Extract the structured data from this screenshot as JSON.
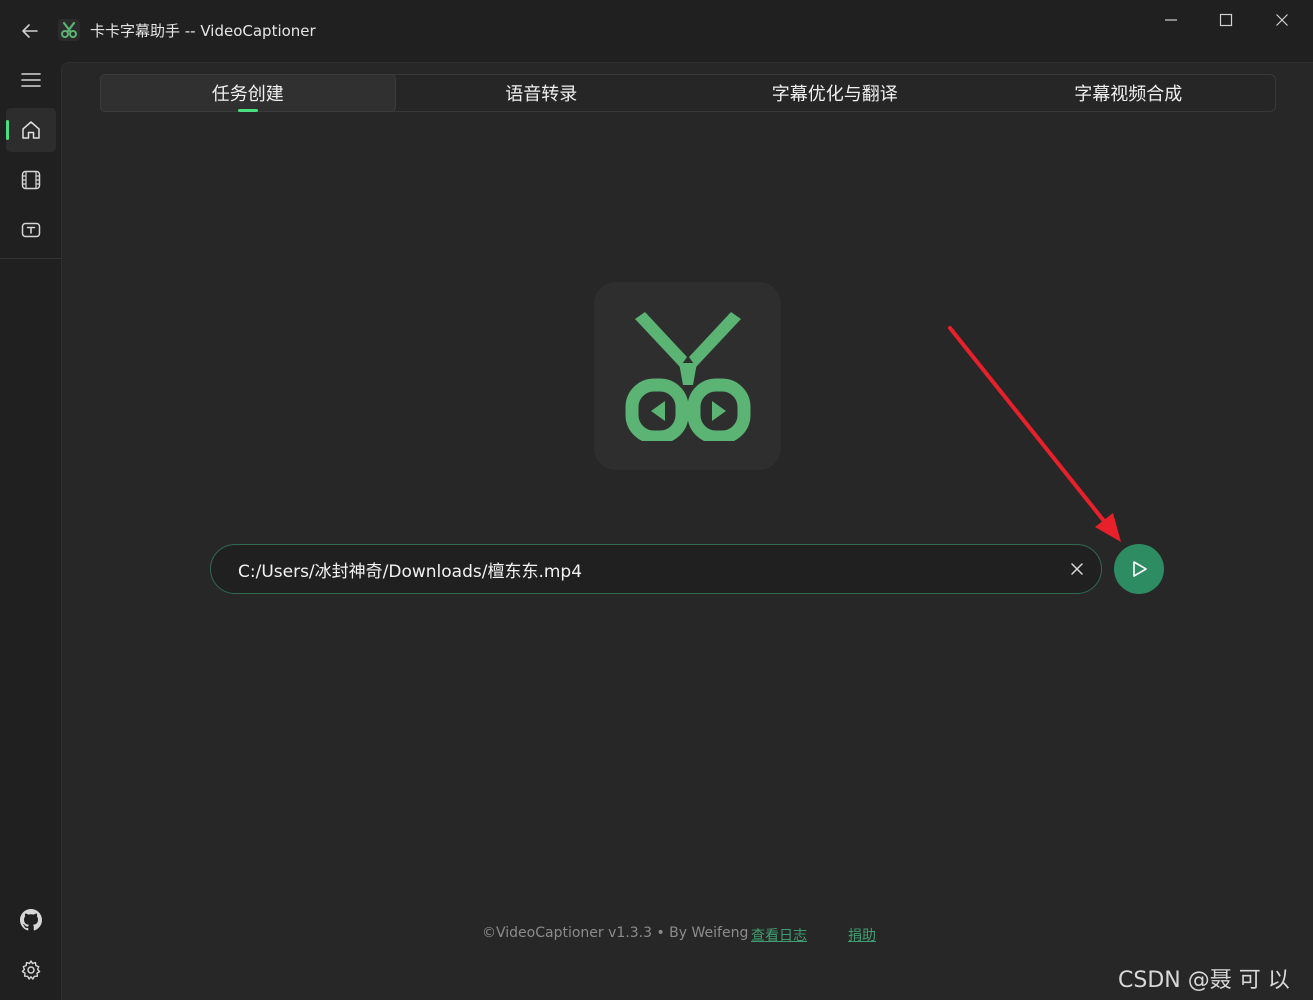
{
  "window": {
    "title": "卡卡字幕助手 -- VideoCaptioner",
    "icons": {
      "back": "back-arrow-icon",
      "app": "scissors-icon",
      "minimize": "minimize-icon",
      "maximize": "maximize-icon",
      "close": "close-icon"
    }
  },
  "nav": {
    "items": [
      {
        "name": "menu",
        "icon": "hamburger-menu-icon"
      },
      {
        "name": "home",
        "icon": "home-icon",
        "active": true
      },
      {
        "name": "video",
        "icon": "film-icon"
      },
      {
        "name": "subtitle",
        "icon": "text-box-icon"
      }
    ],
    "bottom": [
      {
        "name": "github",
        "icon": "github-icon"
      },
      {
        "name": "settings",
        "icon": "gear-icon"
      }
    ]
  },
  "tabs": [
    {
      "label": "任务创建",
      "active": true
    },
    {
      "label": "语音转录",
      "active": false
    },
    {
      "label": "字幕优化与翻译",
      "active": false
    },
    {
      "label": "字幕视频合成",
      "active": false
    }
  ],
  "main": {
    "logo_icon": "scissors-play-logo",
    "file_input": {
      "value": "C:/Users/冰封神奇/Downloads/檀东东.mp4"
    },
    "clear_icon": "clear-x-icon",
    "start_icon": "play-icon"
  },
  "footer": {
    "version": "©VideoCaptioner v1.3.3 • By Weifeng",
    "log_link": "查看日志",
    "donate_link": "捐助"
  },
  "watermark": "CSDN @聂 可 以",
  "colors": {
    "accent": "#4ade80",
    "button": "#2e8c63",
    "logo_green": "#5bb374",
    "annotation_arrow": "#e8202a"
  }
}
